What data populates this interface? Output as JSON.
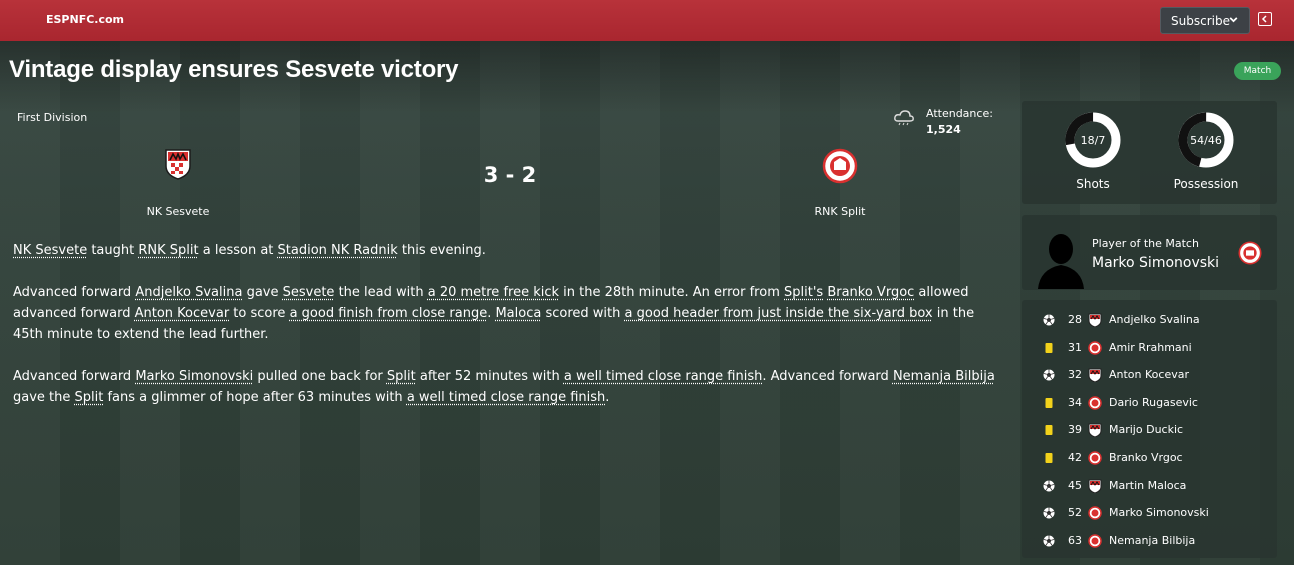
{
  "header": {
    "brand": "ESPNFC.com",
    "subscribe_label": "Subscribe"
  },
  "headline": "Vintage display ensures Sesvete victory",
  "badge": "Match",
  "match": {
    "division": "First Division",
    "attendance_label": "Attendance:",
    "attendance_value": "1,524",
    "score": "3 - 2",
    "home_team": "NK Sesvete",
    "away_team": "RNK Split"
  },
  "report": {
    "p1": [
      {
        "t": "NK Sesvete",
        "u": true
      },
      {
        "t": " taught "
      },
      {
        "t": "RNK Split",
        "u": true
      },
      {
        "t": " a lesson at "
      },
      {
        "t": "Stadion NK Radnik",
        "u": true
      },
      {
        "t": " this evening."
      }
    ],
    "p2": [
      {
        "t": "Advanced forward "
      },
      {
        "t": "Andjelko Svalina",
        "u": true
      },
      {
        "t": " gave "
      },
      {
        "t": "Sesvete",
        "u": true
      },
      {
        "t": " the lead with "
      },
      {
        "t": "a 20 metre free kick",
        "u": true
      },
      {
        "t": " in the 28th minute. An error from "
      },
      {
        "t": "Split's",
        "u": true
      },
      {
        "t": " "
      },
      {
        "t": "Branko Vrgoc",
        "u": true
      },
      {
        "t": " allowed advanced forward "
      },
      {
        "t": "Anton Kocevar",
        "u": true
      },
      {
        "t": " to score "
      },
      {
        "t": "a good finish from close range",
        "u": true
      },
      {
        "t": ". "
      },
      {
        "t": "Maloca",
        "u": true
      },
      {
        "t": " scored with "
      },
      {
        "t": "a good header from just inside the six-yard box",
        "u": true
      },
      {
        "t": " in the 45th minute to extend the lead further."
      }
    ],
    "p3": [
      {
        "t": "Advanced forward "
      },
      {
        "t": "Marko Simonovski",
        "u": true
      },
      {
        "t": " pulled one back for "
      },
      {
        "t": "Split",
        "u": true
      },
      {
        "t": " after 52 minutes with "
      },
      {
        "t": "a well timed close range finish",
        "u": true
      },
      {
        "t": ". Advanced forward "
      },
      {
        "t": "Nemanja Bilbija",
        "u": true
      },
      {
        "t": " gave the "
      },
      {
        "t": "Split",
        "u": true
      },
      {
        "t": " fans a glimmer of hope after 63 minutes with "
      },
      {
        "t": "a well timed close range finish",
        "u": true
      },
      {
        "t": "."
      }
    ]
  },
  "stats": {
    "shots": {
      "label": "Shots",
      "text": "18/7",
      "home": 18,
      "away": 7
    },
    "possession": {
      "label": "Possession",
      "text": "54/46",
      "home": 54,
      "away": 46
    }
  },
  "potm": {
    "label": "Player of the Match",
    "name": "Marko Simonovski"
  },
  "events": [
    {
      "icon": "goal-icon",
      "minute": "28",
      "team": "home",
      "player": "Andjelko Svalina"
    },
    {
      "icon": "yellow-card-icon",
      "minute": "31",
      "team": "away",
      "player": "Amir Rrahmani"
    },
    {
      "icon": "goal-icon",
      "minute": "32",
      "team": "home",
      "player": "Anton Kocevar"
    },
    {
      "icon": "yellow-card-icon",
      "minute": "34",
      "team": "away",
      "player": "Dario Rugasevic"
    },
    {
      "icon": "yellow-card-icon",
      "minute": "39",
      "team": "home",
      "player": "Marijo Duckic"
    },
    {
      "icon": "yellow-card-icon",
      "minute": "42",
      "team": "away",
      "player": "Branko Vrgoc"
    },
    {
      "icon": "goal-icon",
      "minute": "45",
      "team": "home",
      "player": "Martin Maloca"
    },
    {
      "icon": "goal-icon",
      "minute": "52",
      "team": "away",
      "player": "Marko Simonovski"
    },
    {
      "icon": "goal-icon",
      "minute": "63",
      "team": "away",
      "player": "Nemanja Bilbija"
    }
  ],
  "colors": {
    "topbar": "#b8323a",
    "badge": "#3aa35a",
    "yellow_card": "#f2d21b",
    "crest_red": "#d9302f"
  }
}
